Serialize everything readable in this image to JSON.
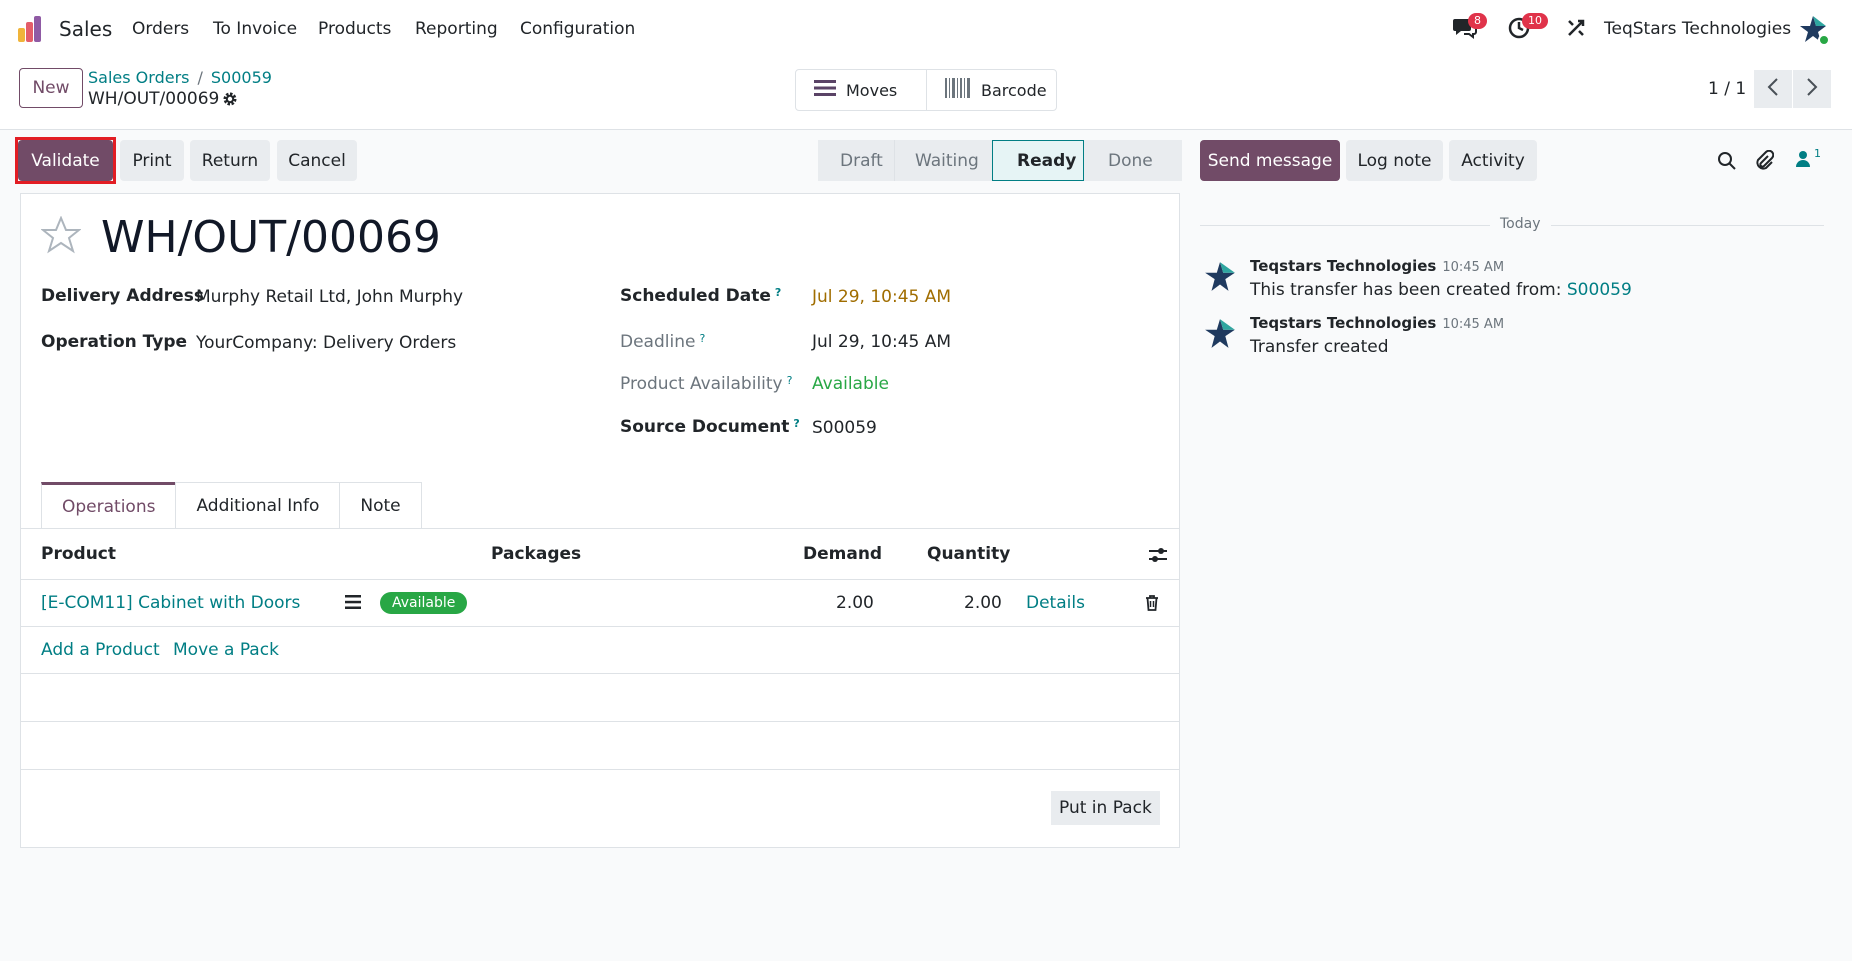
{
  "navbar": {
    "app_name": "Sales",
    "menu": [
      "Orders",
      "To Invoice",
      "Products",
      "Reporting",
      "Configuration"
    ],
    "messages_count": "8",
    "activities_count": "10",
    "company": "TeqStars Technologies"
  },
  "control": {
    "new_label": "New",
    "breadcrumb": [
      "Sales Orders",
      "S00059"
    ],
    "record_name": "WH/OUT/00069",
    "smart_buttons": [
      "Moves",
      "Barcode"
    ],
    "pager": "1 / 1"
  },
  "actions": [
    "Validate",
    "Print",
    "Return",
    "Cancel"
  ],
  "stages": {
    "items": [
      "Draft",
      "Waiting",
      "Ready",
      "Done"
    ],
    "active": "Ready"
  },
  "form": {
    "title": "WH/OUT/00069",
    "delivery_address_label": "Delivery Address",
    "delivery_address": "Murphy Retail Ltd, John Murphy",
    "operation_type_label": "Operation Type",
    "operation_type": "YourCompany: Delivery Orders",
    "scheduled_date_label": "Scheduled Date",
    "scheduled_date": "Jul 29, 10:45 AM",
    "deadline_label": "Deadline",
    "deadline": "Jul 29, 10:45 AM",
    "availability_label": "Product Availability",
    "availability": "Available",
    "source_document_label": "Source Document",
    "source_document": "S00059",
    "help_mark": "?"
  },
  "tabs": [
    "Operations",
    "Additional Info",
    "Note"
  ],
  "table": {
    "headers": [
      "Product",
      "Packages",
      "Demand",
      "Quantity"
    ],
    "rows": [
      {
        "product": "[E-COM11] Cabinet with Doors",
        "status": "Available",
        "demand": "2.00",
        "quantity": "2.00",
        "details": "Details"
      }
    ],
    "add_product": "Add a Product",
    "move_pack": "Move a Pack",
    "put_in_pack": "Put in Pack"
  },
  "chatter": {
    "buttons": [
      "Send message",
      "Log note",
      "Activity"
    ],
    "followers_count": "1",
    "date_separator": "Today",
    "messages": [
      {
        "author": "Teqstars Technologies",
        "time": "10:45 AM",
        "text": "This transfer has been created from:",
        "link": "S00059"
      },
      {
        "author": "Teqstars Technologies",
        "time": "10:45 AM",
        "text": "Transfer created"
      }
    ]
  },
  "colors": {
    "primary": "#714b67",
    "link": "#017e84",
    "warning_date": "#a06d00",
    "success": "#28a745",
    "highlight": "#e21d24"
  }
}
